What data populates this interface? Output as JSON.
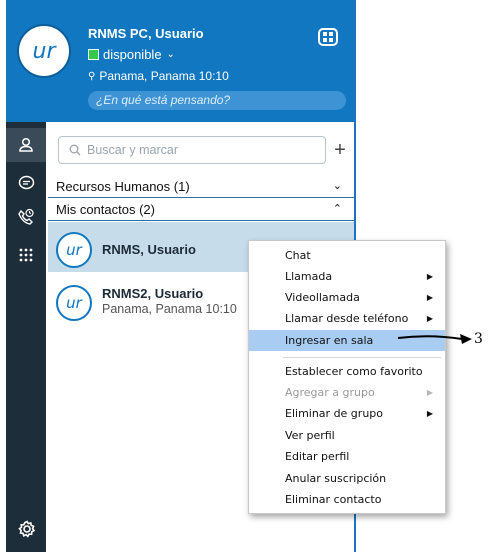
{
  "header": {
    "avatar_initials": "ur",
    "user_name": "RNMS PC, Usuario",
    "presence": "disponible",
    "location": "Panama, Panama  10:10",
    "status_placeholder": "¿En qué está pensando?"
  },
  "search": {
    "placeholder": "Buscar y marcar"
  },
  "groups": [
    {
      "label": "Recursos Humanos (1)",
      "expanded": false
    },
    {
      "label": "Mis contactos (2)",
      "expanded": true
    }
  ],
  "contacts": [
    {
      "initials": "ur",
      "name": "RNMS, Usuario",
      "location": ""
    },
    {
      "initials": "ur",
      "name": "RNMS2, Usuario",
      "location": "Panama, Panama 10:10"
    }
  ],
  "context_menu": {
    "items": [
      {
        "label": "Chat",
        "submenu": false,
        "disabled": false
      },
      {
        "label": "Llamada",
        "submenu": true,
        "disabled": false
      },
      {
        "label": "Videollamada",
        "submenu": true,
        "disabled": false
      },
      {
        "label": "Llamar desde teléfono",
        "submenu": true,
        "disabled": false
      },
      {
        "label": "Ingresar en sala",
        "submenu": false,
        "disabled": false,
        "highlighted": true
      },
      {
        "label": "Establecer como favorito",
        "submenu": false,
        "disabled": false
      },
      {
        "label": "Agregar a grupo",
        "submenu": true,
        "disabled": true
      },
      {
        "label": "Eliminar de grupo",
        "submenu": true,
        "disabled": false
      },
      {
        "label": "Ver perfil",
        "submenu": false,
        "disabled": false
      },
      {
        "label": "Editar perfil",
        "submenu": false,
        "disabled": false
      },
      {
        "label": "Anular suscripción",
        "submenu": false,
        "disabled": false
      },
      {
        "label": "Eliminar contacto",
        "submenu": false,
        "disabled": false
      }
    ]
  },
  "annotation": {
    "label": "3"
  },
  "icons": {
    "apps": "apps-grid-icon",
    "contacts": "person-icon",
    "chat": "chat-bubble-icon",
    "calls": "phone-history-icon",
    "dialpad": "dialpad-icon",
    "settings": "gear-icon",
    "search": "search-icon",
    "add": "plus-icon"
  },
  "colors": {
    "header_bg": "#1177c0",
    "rail_bg": "#1e2d3a",
    "presence_available": "#35c84b",
    "selected_row": "#c7dceb",
    "menu_highlight": "#a9cdf2"
  }
}
